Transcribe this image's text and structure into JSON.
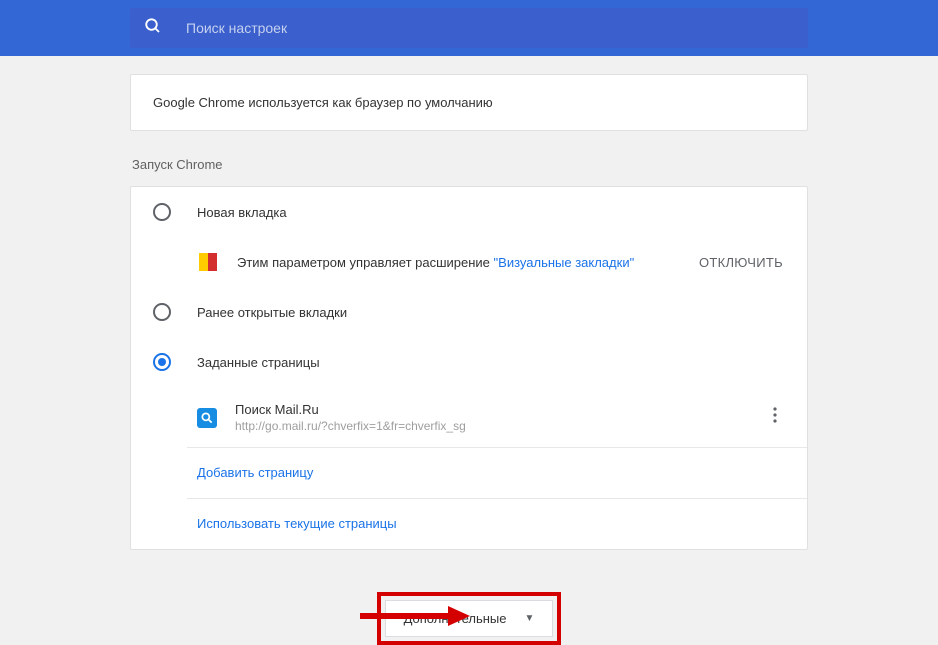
{
  "search": {
    "placeholder": "Поиск настроек"
  },
  "defaultBrowser": {
    "text": "Google Chrome используется как браузер по умолчанию"
  },
  "startup": {
    "title": "Запуск Chrome",
    "options": {
      "newTab": "Новая вкладка",
      "continue": "Ранее открытые вкладки",
      "specific": "Заданные страницы"
    },
    "extension": {
      "text": "Этим параметром управляет расширение ",
      "linkText": "\"Визуальные закладки\"",
      "disable": "ОТКЛЮЧИТЬ"
    },
    "pages": [
      {
        "name": "Поиск Mail.Ru",
        "url": "http://go.mail.ru/?chverfix=1&fr=chverfix_sg"
      }
    ],
    "addPage": "Добавить страницу",
    "useCurrent": "Использовать текущие страницы"
  },
  "advanced": {
    "label": "Дополнительные"
  }
}
